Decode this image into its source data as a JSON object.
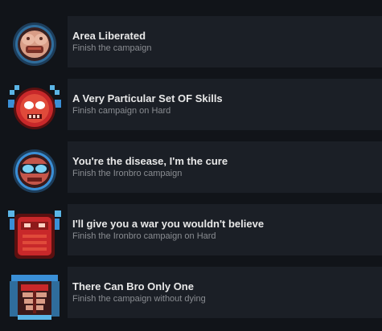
{
  "achievements": [
    {
      "title": "Area Liberated",
      "description": "Finish the campaign",
      "icon": "face-mask-icon"
    },
    {
      "title": "A Very Particular Set OF Skills",
      "description": "Finish campaign on Hard",
      "icon": "red-skull-icon"
    },
    {
      "title": "You're the disease, I'm the cure",
      "description": "Finish the Ironbro campaign",
      "icon": "goggles-face-icon"
    },
    {
      "title": "I'll give you a war you wouldn't believe",
      "description": "Finish the Ironbro campaign on Hard",
      "icon": "red-demon-icon"
    },
    {
      "title": "There Can Bro Only One",
      "description": "Finish the campaign without dying",
      "icon": "armored-torso-icon"
    }
  ],
  "colors": {
    "background": "#111419",
    "panel": "#1b1f26",
    "title_text": "#e8e8e8",
    "description_text": "#8a8d92",
    "accent_red": "#c8282a",
    "accent_blue": "#3a8fd6"
  }
}
